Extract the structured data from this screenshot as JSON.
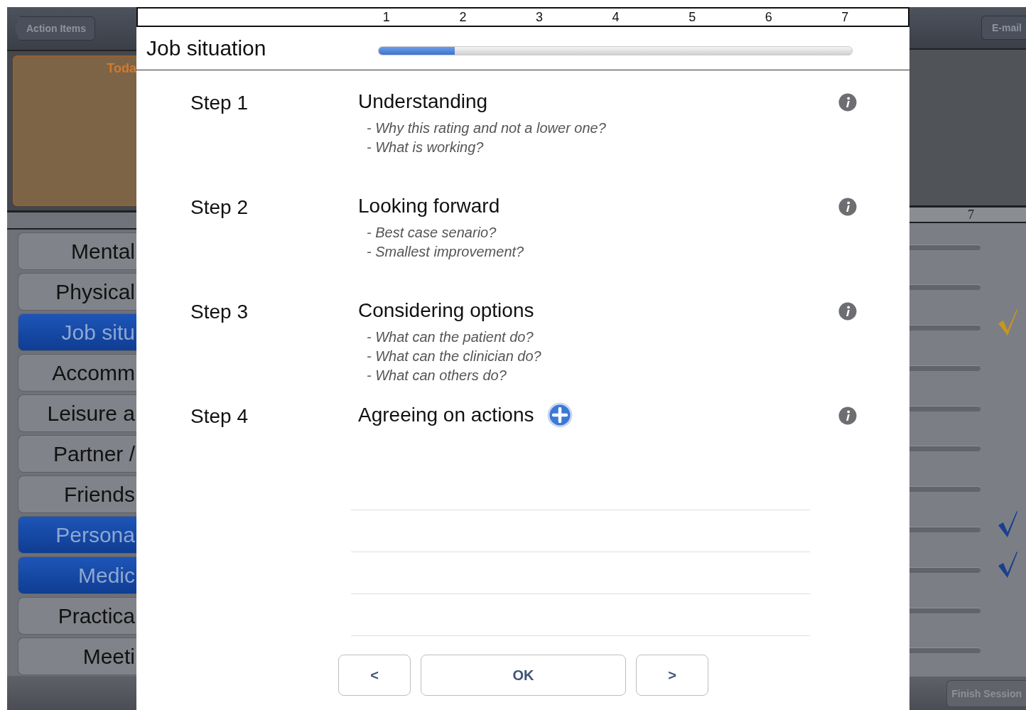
{
  "background": {
    "back_button": "Action Items",
    "email_button": "E-mail",
    "today_card": {
      "title": "Toda"
    },
    "scale_end": "7",
    "categories": [
      {
        "label": "Mental",
        "selected": false,
        "checked": false
      },
      {
        "label": "Physical",
        "selected": false,
        "checked": false
      },
      {
        "label": "Job situ",
        "selected": true,
        "checked": true,
        "color": "#c8961e"
      },
      {
        "label": "Accomm",
        "selected": false,
        "checked": false
      },
      {
        "label": "Leisure a",
        "selected": false,
        "checked": false
      },
      {
        "label": "Partner /",
        "selected": false,
        "checked": false
      },
      {
        "label": "Friends",
        "selected": false,
        "checked": false
      },
      {
        "label": "Persona",
        "selected": true,
        "checked": true,
        "color": "#1a3f8f"
      },
      {
        "label": "Medic",
        "selected": true,
        "checked": true,
        "color": "#1a3f8f"
      },
      {
        "label": "Practica",
        "selected": false,
        "checked": false
      },
      {
        "label": "Meeti",
        "selected": false,
        "checked": false
      }
    ],
    "finish_button": "Finish Session"
  },
  "dialog": {
    "scale": [
      "1",
      "2",
      "3",
      "4",
      "5",
      "6",
      "7"
    ],
    "title": "Job situation",
    "progress": {
      "level": 0.16
    },
    "steps": [
      {
        "label": "Step 1",
        "title": "Understanding",
        "add": false,
        "questions": [
          "- Why this rating and not a lower one?",
          "- What is working?"
        ]
      },
      {
        "label": "Step 2",
        "title": "Looking forward",
        "add": false,
        "questions": [
          "- Best case senario?",
          "- Smallest improvement?"
        ]
      },
      {
        "label": "Step 3",
        "title": "Considering options",
        "add": false,
        "questions": [
          "- What can the patient do?",
          "- What can the clinician do?",
          "- What can others do?"
        ]
      },
      {
        "label": "Step 4",
        "title": "Agreeing on actions",
        "add": true
      }
    ],
    "buttons": [
      {
        "label": "<",
        "kind": "prev"
      },
      {
        "label": "OK",
        "kind": "ok"
      },
      {
        "label": ">",
        "kind": "next"
      }
    ]
  }
}
